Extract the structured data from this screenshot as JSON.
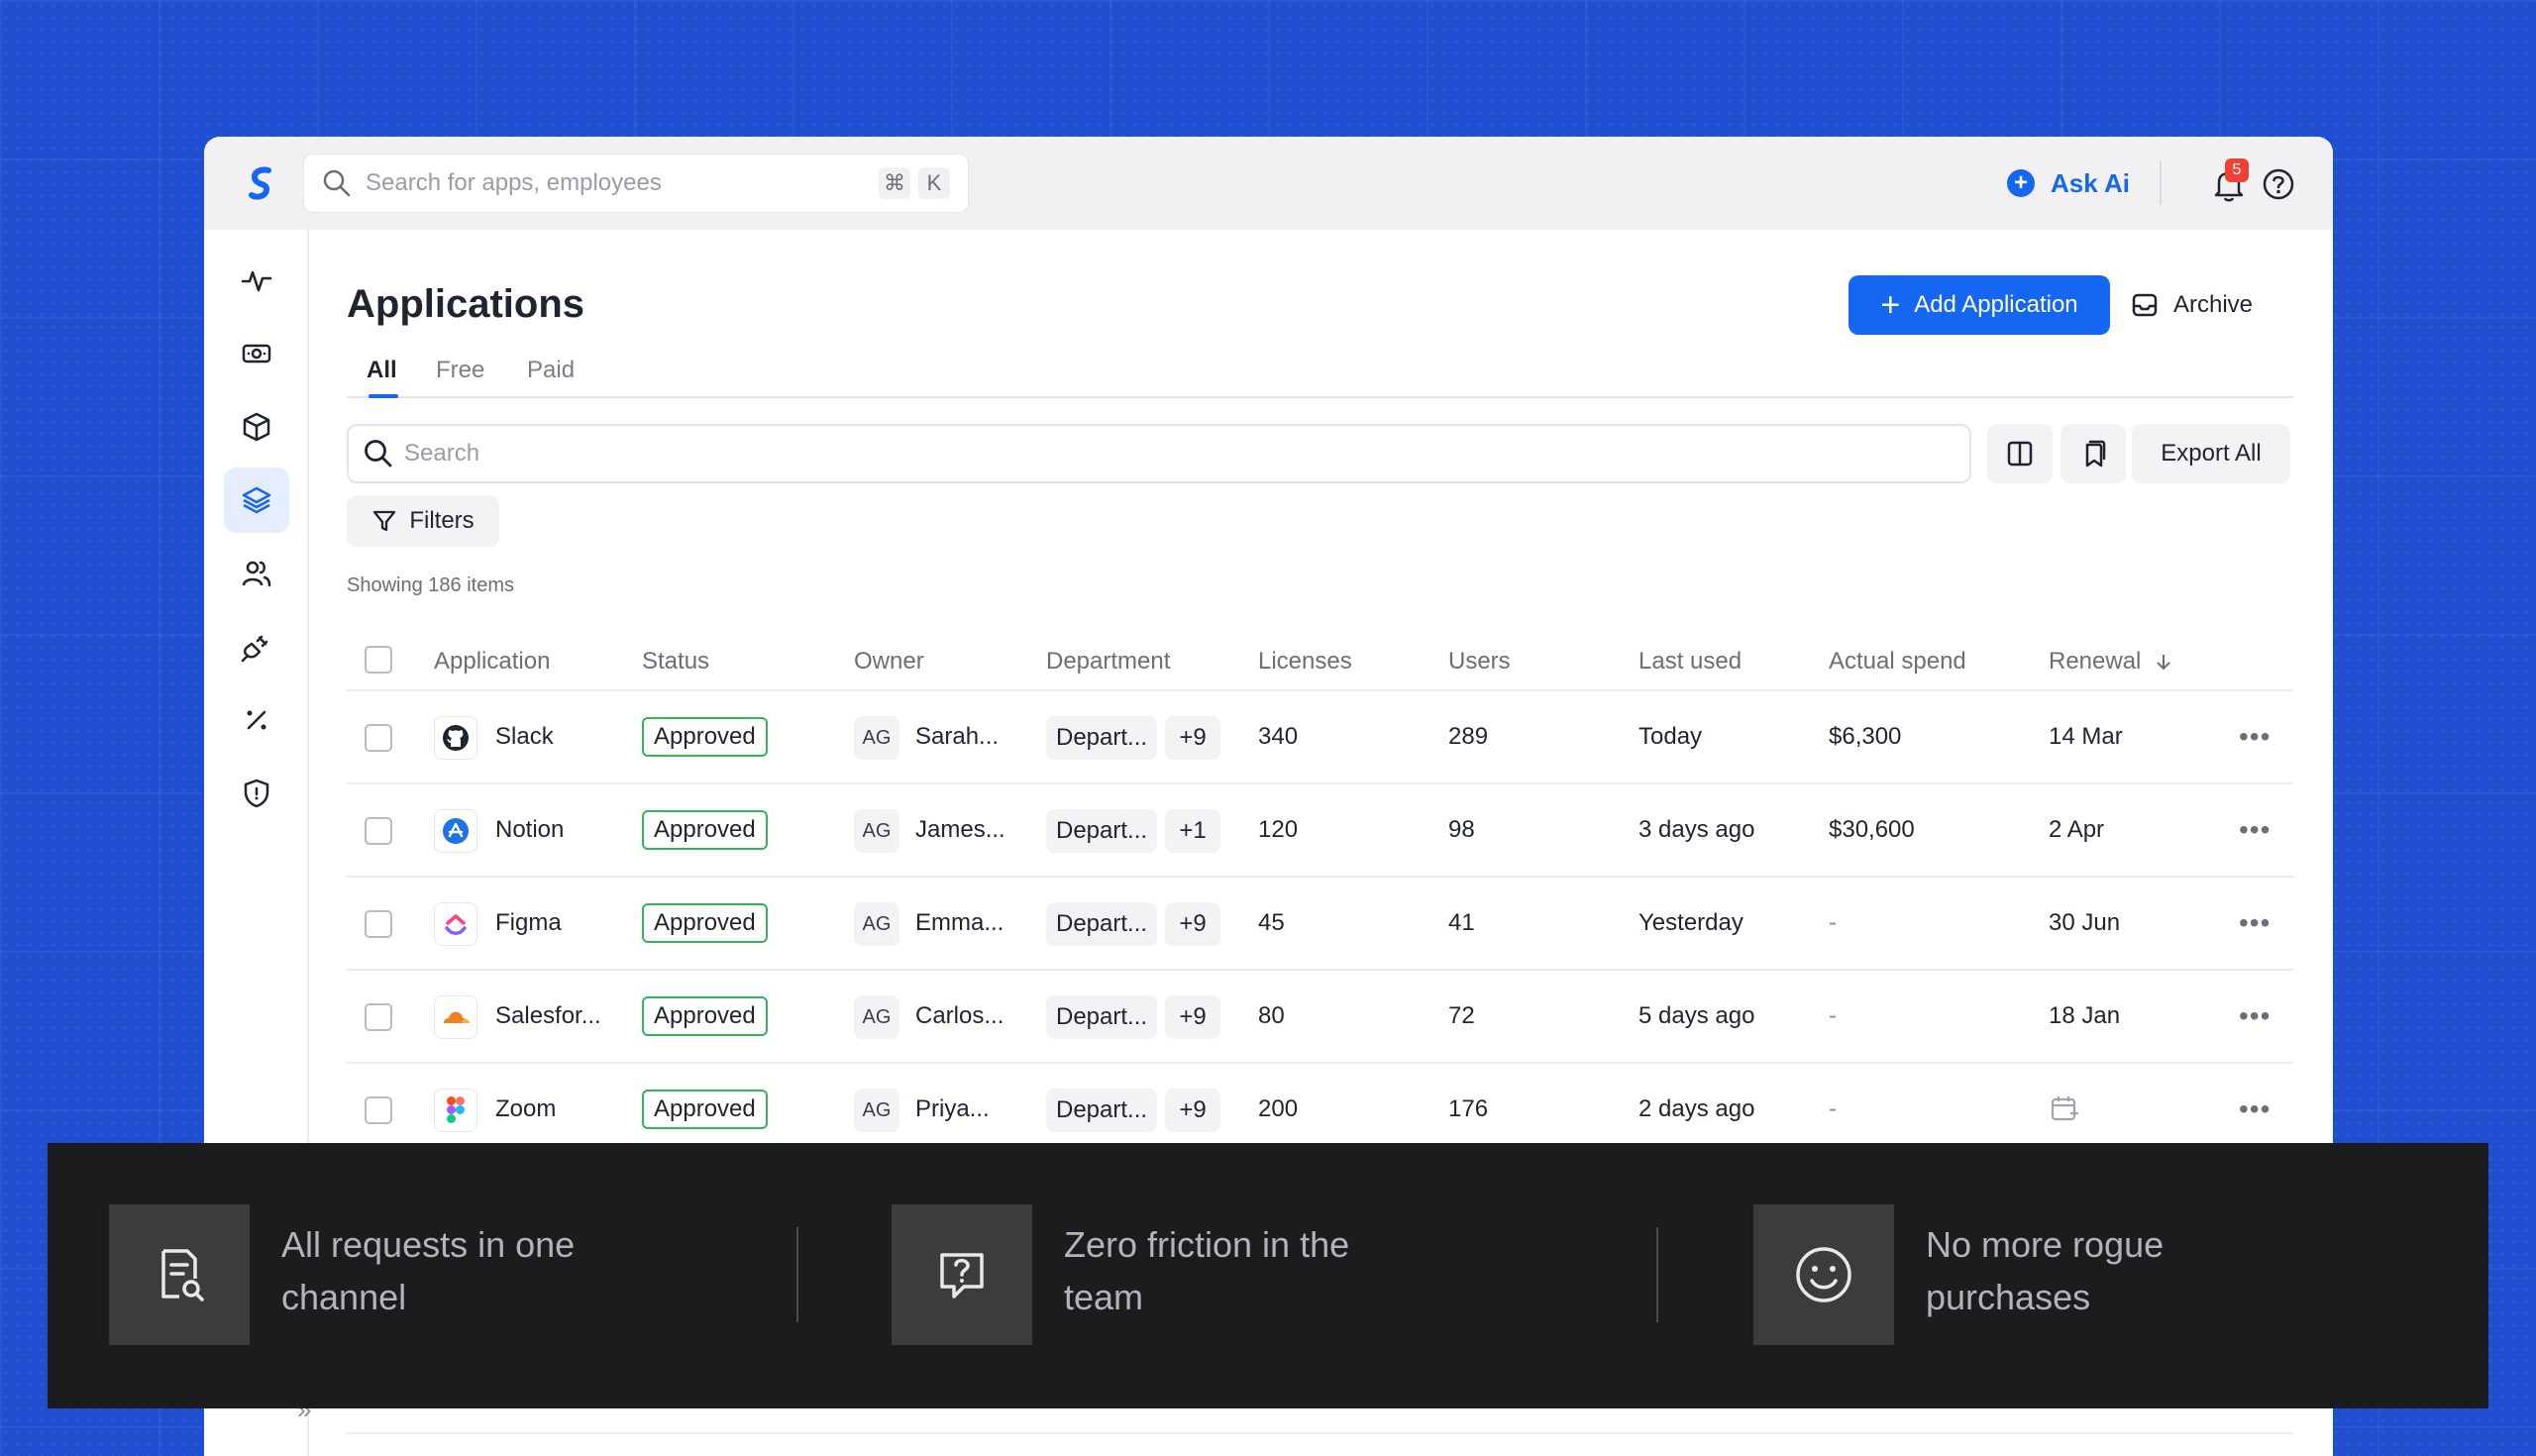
{
  "topbar": {
    "search_placeholder": "Search for apps, employees",
    "shortcut_cmd": "⌘",
    "shortcut_key": "K",
    "ask_ai_label": "Ask Ai",
    "notification_count": "5"
  },
  "sidebar": {
    "items": [
      {
        "icon": "activity-icon"
      },
      {
        "icon": "money-icon"
      },
      {
        "icon": "box-icon"
      },
      {
        "icon": "layers-icon",
        "active": true
      },
      {
        "icon": "users-icon"
      },
      {
        "icon": "plug-icon"
      },
      {
        "icon": "percent-icon"
      },
      {
        "icon": "shield-icon"
      }
    ]
  },
  "page": {
    "title": "Applications",
    "add_button": "Add Application",
    "archive_button": "Archive",
    "tabs": [
      "All",
      "Free",
      "Paid"
    ],
    "active_tab": "All",
    "search_placeholder": "Search",
    "export_button": "Export All",
    "filters_button": "Filters",
    "showing_text": "Showing 186 items"
  },
  "table": {
    "columns": [
      "Application",
      "Status",
      "Owner",
      "Department",
      "Licenses",
      "Users",
      "Last used",
      "Actual spend",
      "Renewal"
    ],
    "rows": [
      {
        "app": "Slack",
        "icon": "github-icon",
        "status": "Approved",
        "owner_initials": "AG",
        "owner": "Sarah...",
        "dept": "Depart...",
        "dept_more": "+9",
        "licenses": "340",
        "users": "289",
        "last_used": "Today",
        "spend": "$6,300",
        "renewal": "14 Mar"
      },
      {
        "app": "Notion",
        "icon": "appstore-icon",
        "status": "Approved",
        "owner_initials": "AG",
        "owner": "James...",
        "dept": "Depart...",
        "dept_more": "+1",
        "licenses": "120",
        "users": "98",
        "last_used": "3 days ago",
        "spend": "$30,600",
        "renewal": "2 Apr"
      },
      {
        "app": "Figma",
        "icon": "clickup-icon",
        "status": "Approved",
        "owner_initials": "AG",
        "owner": "Emma...",
        "dept": "Depart...",
        "dept_more": "+9",
        "licenses": "45",
        "users": "41",
        "last_used": "Yesterday",
        "spend": "-",
        "renewal": "30 Jun"
      },
      {
        "app": "Salesfor...",
        "icon": "cloudflare-icon",
        "status": "Approved",
        "owner_initials": "AG",
        "owner": "Carlos...",
        "dept": "Depart...",
        "dept_more": "+9",
        "licenses": "80",
        "users": "72",
        "last_used": "5 days ago",
        "spend": "-",
        "renewal": "18 Jan"
      },
      {
        "app": "Zoom",
        "icon": "figma-icon",
        "status": "Approved",
        "owner_initials": "AG",
        "owner": "Priya...",
        "dept": "Depart...",
        "dept_more": "+9",
        "licenses": "200",
        "users": "176",
        "last_used": "2 days ago",
        "spend": "-",
        "renewal": ""
      }
    ]
  },
  "features": [
    {
      "icon": "document-search-icon",
      "text": "All requests in one channel"
    },
    {
      "icon": "question-chat-icon",
      "text": "Zero friction in the team"
    },
    {
      "icon": "smiley-icon",
      "text": "No more rogue purchases"
    }
  ],
  "colors": {
    "accent": "#1566f0",
    "background": "#1f4fd0",
    "approved_border": "#36b35a",
    "badge": "#ef4134",
    "overlay": "#1c1c1e"
  }
}
